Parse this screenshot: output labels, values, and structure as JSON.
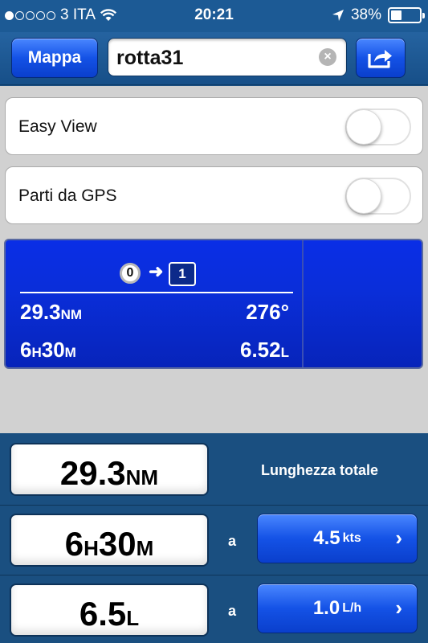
{
  "status_bar": {
    "carrier": "3 ITA",
    "time": "20:21",
    "battery": "38%",
    "battery_level": 0.38
  },
  "nav": {
    "map_button": "Mappa",
    "route_name": "rotta31"
  },
  "toggles": [
    {
      "label": "Easy View",
      "on": false
    },
    {
      "label": "Parti da GPS",
      "on": false
    }
  ],
  "leg": {
    "from": "0",
    "to": "1",
    "distance_value": "29.3",
    "distance_unit": "NM",
    "bearing": "276°",
    "time_h": "6",
    "time_h_unit": "H",
    "time_m": "30",
    "time_m_unit": "M",
    "fuel_value": "6.52",
    "fuel_unit": "L"
  },
  "summary": {
    "total_length_value": "29.3",
    "total_length_unit": "NM",
    "total_length_label": "Lunghezza totale",
    "duration_h": "6",
    "duration_h_unit": "H",
    "duration_m": "30",
    "duration_m_unit": "M",
    "at_label": "a",
    "speed_value": "4.5",
    "speed_unit": "kts",
    "fuel_value": "6.5",
    "fuel_unit": "L",
    "consumption_value": "1.0",
    "consumption_unit": "L/h"
  }
}
